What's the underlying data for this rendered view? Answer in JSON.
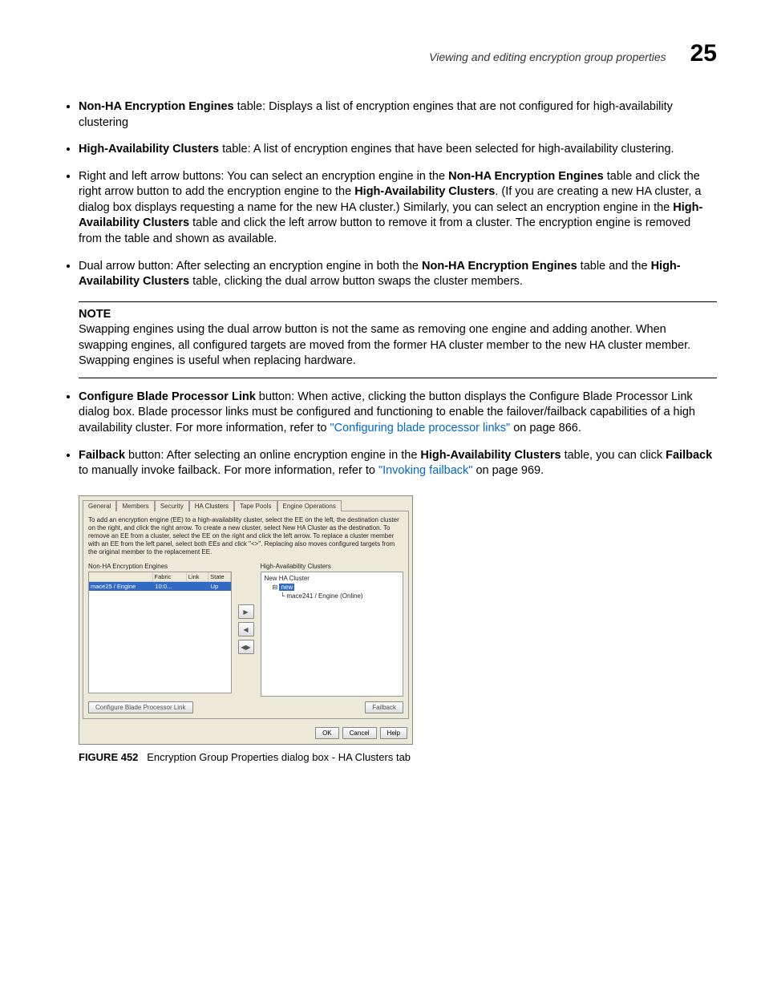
{
  "header": {
    "title": "Viewing and editing encryption group properties",
    "chapter": "25"
  },
  "bullets": {
    "b1": {
      "bold": "Non-HA Encryption Engines",
      "rest": " table: Displays a list of encryption engines that are not configured for high-availability clustering"
    },
    "b2": {
      "bold": "High-Availability Clusters",
      "rest": " table: A list of encryption engines that have been selected for high-availability clustering."
    },
    "b3": {
      "p1": "Right and left arrow buttons: You can select an encryption engine in the ",
      "b1": "Non-HA Encryption Engines",
      "p2": " table and click the right arrow button to add the encryption engine to the ",
      "b2": "High-Availability Clusters",
      "p3": ". (If you are creating a new HA cluster, a dialog box displays requesting a name for the new HA cluster.) Similarly, you can select an encryption engine in the ",
      "b3": "High-Availability Clusters",
      "p4": " table and click the left arrow button to remove it from a cluster. The encryption engine is removed from the table and shown as available."
    },
    "b4": {
      "p1": "Dual arrow button: After selecting an encryption engine in both the ",
      "b1": "Non-HA Encryption Engines",
      "p2": " table and the ",
      "b2": "High-Availability Clusters",
      "p3": " table, clicking the dual arrow button swaps the cluster members."
    },
    "b5": {
      "b1": "Configure Blade Processor Link",
      "p1": " button: When active, clicking the button displays the Configure Blade Processor Link dialog box. Blade processor links must be configured and functioning to enable the failover/failback capabilities of a high availability cluster. For more information, refer to ",
      "link": "\"Configuring blade processor links\"",
      "p2": " on page 866."
    },
    "b6": {
      "b1": "Failback",
      "p1": " button: After selecting an online encryption engine in the ",
      "b2": "High-Availability Clusters",
      "p2": " table, you can click ",
      "b3": "Failback",
      "p3": " to manually invoke failback. For more information, refer to ",
      "link": "\"Invoking failback\"",
      "p4": " on page 969."
    }
  },
  "note": {
    "label": "NOTE",
    "body": "Swapping engines using the dual arrow button is not the same as removing one engine and adding another. When swapping engines, all configured targets are moved from the former HA cluster member to the new HA cluster member. Swapping engines is useful when replacing hardware."
  },
  "dialog": {
    "tabs": [
      "General",
      "Members",
      "Security",
      "HA Clusters",
      "Tape Pools",
      "Engine Operations"
    ],
    "instructions": "To add an encryption engine (EE) to a high-availability cluster, select the EE on the left, the destination cluster on the right, and click the right arrow. To create a new cluster, select New HA Cluster as the destination. To remove an EE from a cluster, select the EE on the right and click the left arrow.  To replace a cluster member with an EE from the left panel, select both EEs and click \"<>\". Replacing also moves configured targets from the original member to the replacement EE.",
    "left_title": "Non-HA Encryption Engines",
    "left_headers": [
      "",
      "Fabric",
      "Link",
      "State"
    ],
    "left_row": {
      "name": "mace25 / Engine",
      "fabric": "10:0...",
      "link": "",
      "state": "Up"
    },
    "right_title": "High-Availability Clusters",
    "tree": {
      "l1": "New HA Cluster",
      "l2": "new",
      "l3": "mace241 / Engine (Online)"
    },
    "btn_configure": "Configure Blade Processor Link",
    "btn_failback": "Failback",
    "btn_ok": "OK",
    "btn_cancel": "Cancel",
    "btn_help": "Help"
  },
  "caption": {
    "label": "FIGURE 452",
    "text": "Encryption Group Properties dialog box - HA Clusters tab"
  }
}
